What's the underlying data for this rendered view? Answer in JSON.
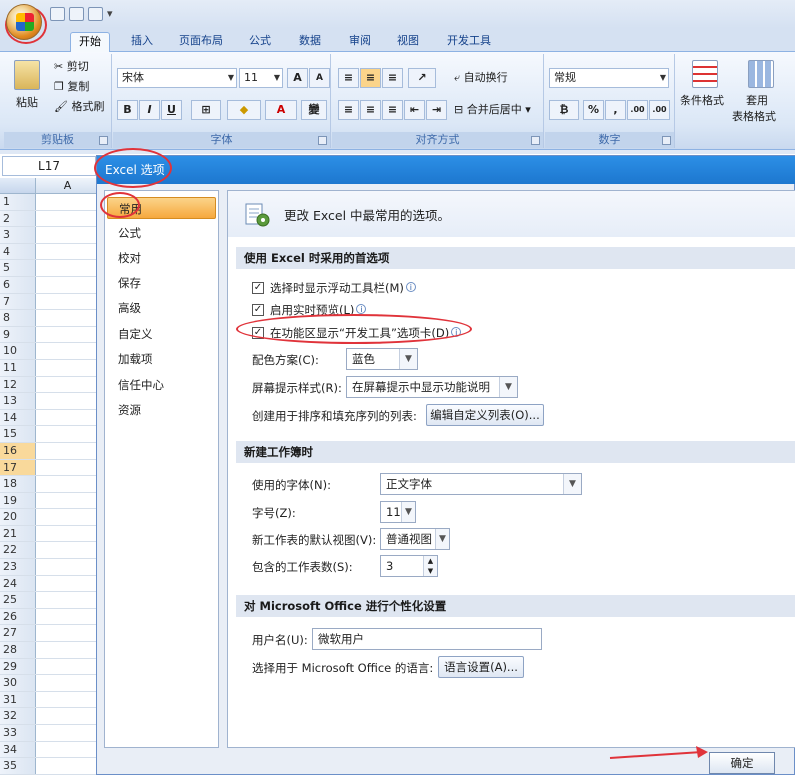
{
  "tabs": {
    "home": "开始",
    "insert": "插入",
    "page_layout": "页面布局",
    "formulas": "公式",
    "data": "数据",
    "review": "审阅",
    "view": "视图",
    "developer": "开发工具"
  },
  "ribbon": {
    "clipboard": {
      "label": "剪贴板",
      "paste": "粘贴",
      "cut": "剪切",
      "copy": "复制",
      "format_painter": "格式刷"
    },
    "font": {
      "label": "字体",
      "font_name": "宋体",
      "font_size": "11",
      "grow": "A",
      "shrink": "A",
      "bold": "B",
      "italic": "I",
      "underline": "U",
      "phonetic": "變"
    },
    "alignment": {
      "label": "对齐方式",
      "wrap_text": "自动换行",
      "merge_center": "合并后居中"
    },
    "number": {
      "label": "数字",
      "format": "常规",
      "percent": "%",
      "comma": ",",
      "inc_decimal": ".00",
      "dec_decimal": ".00"
    },
    "styles": {
      "conditional": "条件格式",
      "table_format_1": "套用",
      "table_format_2": "表格格式"
    }
  },
  "sheet": {
    "name_box": "L17",
    "column_a": "A",
    "rows": [
      "1",
      "2",
      "3",
      "4",
      "5",
      "6",
      "7",
      "8",
      "9",
      "10",
      "11",
      "12",
      "13",
      "14",
      "15",
      "16",
      "17",
      "18",
      "19",
      "20",
      "21",
      "22",
      "23",
      "24",
      "25",
      "26",
      "27",
      "28",
      "29",
      "30",
      "31",
      "32",
      "33",
      "34",
      "35"
    ],
    "selected_rows": [
      "16",
      "17"
    ]
  },
  "dialog": {
    "title": "Excel 选项",
    "nav": [
      "常用",
      "公式",
      "校对",
      "保存",
      "高级",
      "自定义",
      "加载项",
      "信任中心",
      "资源"
    ],
    "header": "更改 Excel 中最常用的选项。",
    "sections": {
      "top": "使用 Excel 时采用的首选项",
      "new_workbook": "新建工作簿时",
      "personalize": "对 Microsoft Office 进行个性化设置"
    },
    "options": {
      "mini_toolbar": "选择时显示浮动工具栏(M)",
      "live_preview": "启用实时预览(L)",
      "developer_tab": "在功能区显示“开发工具”选项卡(D)",
      "color_scheme_label": "配色方案(C):",
      "color_scheme_value": "蓝色",
      "screentip_label": "屏幕提示样式(R):",
      "screentip_value": "在屏幕提示中显示功能说明",
      "custom_lists_label": "创建用于排序和填充序列的列表:",
      "custom_lists_button": "编辑自定义列表(O)...",
      "font_label": "使用的字体(N):",
      "font_value": "正文字体",
      "size_label": "字号(Z):",
      "size_value": "11",
      "default_view_label": "新工作表的默认视图(V):",
      "default_view_value": "普通视图",
      "sheets_label": "包含的工作表数(S):",
      "sheets_value": "3",
      "username_label": "用户名(U):",
      "username_value": "微软用户",
      "language_label": "选择用于 Microsoft Office 的语言:",
      "language_button": "语言设置(A)..."
    },
    "ok": "确定"
  },
  "colors": {
    "accent": "#1d77cf",
    "highlight": "#f6a83e",
    "annotation": "#e0333a"
  }
}
